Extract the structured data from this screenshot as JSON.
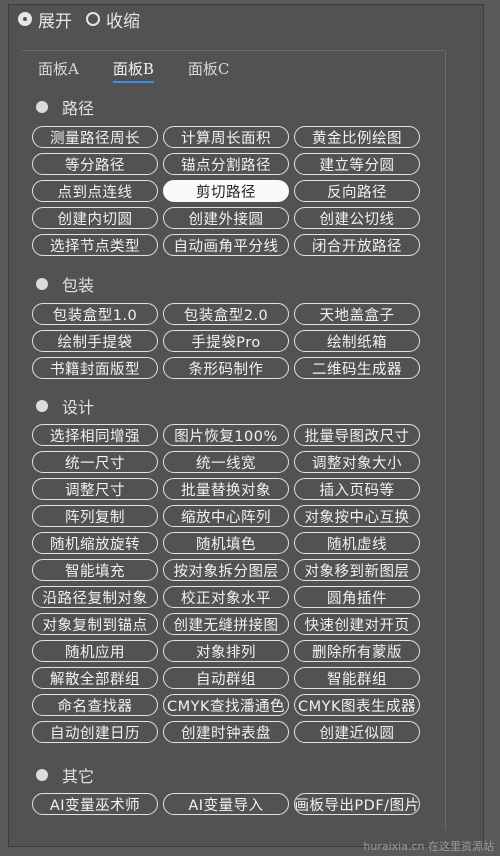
{
  "mode": {
    "expand_label": "展开",
    "collapse_label": "收缩",
    "selected": "expand"
  },
  "tabs": [
    {
      "label": "面板A"
    },
    {
      "label": "面板B",
      "active": true
    },
    {
      "label": "面板C"
    }
  ],
  "sections": [
    {
      "title": "路径",
      "buttons": [
        "测量路径周长",
        "计算周长面积",
        "黄金比例绘图",
        "等分路径",
        "锚点分割路径",
        "建立等分圆",
        "点到点连线",
        "剪切路径",
        "反向路径",
        "创建内切圆",
        "创建外接圆",
        "创建公切线",
        "选择节点类型",
        "自动画角平分线",
        "闭合开放路径"
      ],
      "selected": "剪切路径"
    },
    {
      "title": "包装",
      "buttons": [
        "包装盒型1.0",
        "包装盒型2.0",
        "天地盖盒子",
        "绘制手提袋",
        "手提袋Pro",
        "绘制纸箱",
        "书籍封面版型",
        "条形码制作",
        "二维码生成器"
      ]
    },
    {
      "title": "设计",
      "buttons": [
        "选择相同增强",
        "图片恢复100%",
        "批量导图改尺寸",
        "统一尺寸",
        "统一线宽",
        "调整对象大小",
        "调整尺寸",
        "批量替换对象",
        "插入页码等",
        "阵列复制",
        "缩放中心阵列",
        "对象按中心互换",
        "随机缩放旋转",
        "随机填色",
        "随机虚线",
        "智能填充",
        "按对象拆分图层",
        "对象移到新图层",
        "沿路径复制对象",
        "校正对象水平",
        "圆角插件",
        "对象复制到锚点",
        "创建无缝拼接图",
        "快速创建对开页",
        "随机应用",
        "对象排列",
        "删除所有蒙版",
        "解散全部群组",
        "自动群组",
        "智能群组",
        "命名查找器",
        "CMYK查找潘通色",
        "CMYK图表生成器",
        "自动创建日历",
        "创建时钟表盘",
        "创建近似圆"
      ]
    },
    {
      "title": "其它",
      "buttons": [
        "AI变量巫术师",
        "AI变量导入",
        "画板导出PDF/图片"
      ]
    }
  ],
  "watermark": "huraixia.cn 在这里资源站"
}
